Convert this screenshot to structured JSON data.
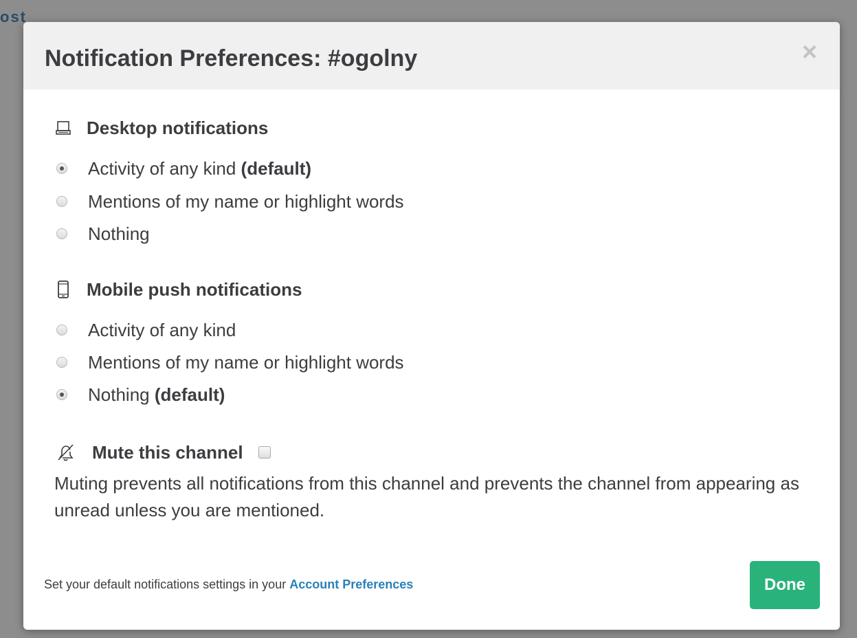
{
  "background": {
    "fragment_text": "ost"
  },
  "modal": {
    "title": "Notification Preferences: #ogolny",
    "close_label": "×"
  },
  "desktop": {
    "heading": "Desktop notifications",
    "icon": "laptop-icon",
    "options": [
      {
        "label": "Activity of any kind",
        "suffix": "(default)",
        "checked": true
      },
      {
        "label": "Mentions of my name or highlight words",
        "suffix": "",
        "checked": false
      },
      {
        "label": "Nothing",
        "suffix": "",
        "checked": false
      }
    ]
  },
  "mobile": {
    "heading": "Mobile push notifications",
    "icon": "mobile-phone-icon",
    "options": [
      {
        "label": "Activity of any kind",
        "suffix": "",
        "checked": false
      },
      {
        "label": "Mentions of my name or highlight words",
        "suffix": "",
        "checked": false
      },
      {
        "label": "Nothing",
        "suffix": "(default)",
        "checked": true
      }
    ]
  },
  "mute": {
    "label": "Mute this channel",
    "icon": "bell-slash-icon",
    "checked": false,
    "description": "Muting prevents all notifications from this channel and prevents the channel from appearing as unread unless you are mentioned."
  },
  "footer": {
    "note_prefix": "Set your default notifications settings in your ",
    "link_label": "Account Preferences",
    "done_label": "Done"
  },
  "colors": {
    "accent_green": "#2ab27b",
    "link_blue": "#2a80b9",
    "text": "#3d3c40",
    "header_bg": "#f0f0f0",
    "backdrop": "#8d8d8d"
  }
}
